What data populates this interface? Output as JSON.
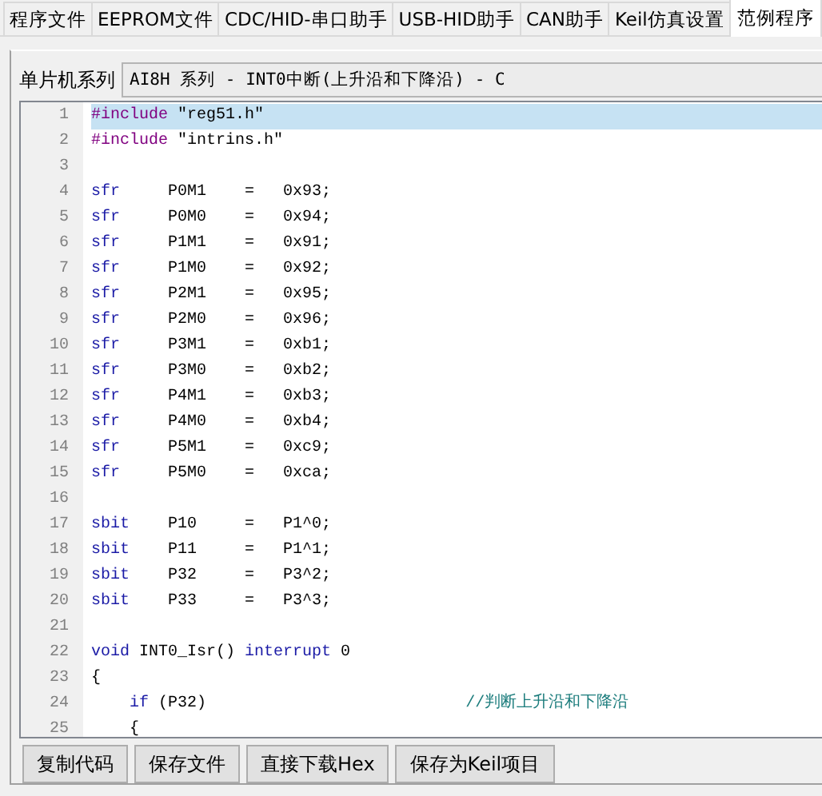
{
  "tabs": [
    {
      "label": "程序文件",
      "selected": false
    },
    {
      "label": "EEPROM文件",
      "selected": false
    },
    {
      "label": "CDC/HID-串口助手",
      "selected": false
    },
    {
      "label": "USB-HID助手",
      "selected": false
    },
    {
      "label": "CAN助手",
      "selected": false
    },
    {
      "label": "Keil仿真设置",
      "selected": false
    },
    {
      "label": "范例程序",
      "selected": true
    }
  ],
  "series_label": "单片机系列",
  "series_select": {
    "value": "AI8H 系列 - INT0中断(上升沿和下降沿) - C"
  },
  "code_lines": [
    {
      "number": "1",
      "selected": true,
      "segments": [
        {
          "kind": "preprocessor",
          "text": "#include"
        },
        {
          "kind": "plain",
          "text": " \"reg51.h\""
        }
      ]
    },
    {
      "number": "2",
      "selected": false,
      "segments": [
        {
          "kind": "preprocessor",
          "text": "#include"
        },
        {
          "kind": "plain",
          "text": " \"intrins.h\""
        }
      ]
    },
    {
      "number": "3",
      "selected": false
    },
    {
      "number": "4",
      "selected": false,
      "segments": [
        {
          "kind": "keyword",
          "text": "sfr"
        },
        {
          "kind": "plain",
          "text": "     P0M1    =   0x93;"
        }
      ]
    },
    {
      "number": "5",
      "selected": false,
      "segments": [
        {
          "kind": "keyword",
          "text": "sfr"
        },
        {
          "kind": "plain",
          "text": "     P0M0    =   0x94;"
        }
      ]
    },
    {
      "number": "6",
      "selected": false,
      "segments": [
        {
          "kind": "keyword",
          "text": "sfr"
        },
        {
          "kind": "plain",
          "text": "     P1M1    =   0x91;"
        }
      ]
    },
    {
      "number": "7",
      "selected": false,
      "segments": [
        {
          "kind": "keyword",
          "text": "sfr"
        },
        {
          "kind": "plain",
          "text": "     P1M0    =   0x92;"
        }
      ]
    },
    {
      "number": "8",
      "selected": false,
      "segments": [
        {
          "kind": "keyword",
          "text": "sfr"
        },
        {
          "kind": "plain",
          "text": "     P2M1    =   0x95;"
        }
      ]
    },
    {
      "number": "9",
      "selected": false,
      "segments": [
        {
          "kind": "keyword",
          "text": "sfr"
        },
        {
          "kind": "plain",
          "text": "     P2M0    =   0x96;"
        }
      ]
    },
    {
      "number": "10",
      "selected": false,
      "segments": [
        {
          "kind": "keyword",
          "text": "sfr"
        },
        {
          "kind": "plain",
          "text": "     P3M1    =   0xb1;"
        }
      ]
    },
    {
      "number": "11",
      "selected": false,
      "segments": [
        {
          "kind": "keyword",
          "text": "sfr"
        },
        {
          "kind": "plain",
          "text": "     P3M0    =   0xb2;"
        }
      ]
    },
    {
      "number": "12",
      "selected": false,
      "segments": [
        {
          "kind": "keyword",
          "text": "sfr"
        },
        {
          "kind": "plain",
          "text": "     P4M1    =   0xb3;"
        }
      ]
    },
    {
      "number": "13",
      "selected": false,
      "segments": [
        {
          "kind": "keyword",
          "text": "sfr"
        },
        {
          "kind": "plain",
          "text": "     P4M0    =   0xb4;"
        }
      ]
    },
    {
      "number": "14",
      "selected": false,
      "segments": [
        {
          "kind": "keyword",
          "text": "sfr"
        },
        {
          "kind": "plain",
          "text": "     P5M1    =   0xc9;"
        }
      ]
    },
    {
      "number": "15",
      "selected": false,
      "segments": [
        {
          "kind": "keyword",
          "text": "sfr"
        },
        {
          "kind": "plain",
          "text": "     P5M0    =   0xca;"
        }
      ]
    },
    {
      "number": "16",
      "selected": false
    },
    {
      "number": "17",
      "selected": false,
      "segments": [
        {
          "kind": "keyword",
          "text": "sbit"
        },
        {
          "kind": "plain",
          "text": "    P10     =   P1^0;"
        }
      ]
    },
    {
      "number": "18",
      "selected": false,
      "segments": [
        {
          "kind": "keyword",
          "text": "sbit"
        },
        {
          "kind": "plain",
          "text": "    P11     =   P1^1;"
        }
      ]
    },
    {
      "number": "19",
      "selected": false,
      "segments": [
        {
          "kind": "keyword",
          "text": "sbit"
        },
        {
          "kind": "plain",
          "text": "    P32     =   P3^2;"
        }
      ]
    },
    {
      "number": "20",
      "selected": false,
      "segments": [
        {
          "kind": "keyword",
          "text": "sbit"
        },
        {
          "kind": "plain",
          "text": "    P33     =   P3^3;"
        }
      ]
    },
    {
      "number": "21",
      "selected": false
    },
    {
      "number": "22",
      "selected": false,
      "segments": [
        {
          "kind": "keyword",
          "text": "void"
        },
        {
          "kind": "plain",
          "text": " INT0_Isr() "
        },
        {
          "kind": "keyword",
          "text": "interrupt"
        },
        {
          "kind": "plain",
          "text": " 0"
        }
      ]
    },
    {
      "number": "23",
      "selected": false,
      "segments": [
        {
          "kind": "plain",
          "text": "{"
        }
      ]
    },
    {
      "number": "24",
      "selected": false,
      "indented": true,
      "segments": [
        {
          "kind": "keyword",
          "text": "if"
        },
        {
          "kind": "plain",
          "text": " (P32)                           "
        },
        {
          "kind": "comment",
          "text": "//判断上升沿和下降沿"
        }
      ]
    },
    {
      "number": "25",
      "selected": false,
      "indented": true,
      "segments": [
        {
          "kind": "plain",
          "text": "{"
        }
      ]
    }
  ],
  "buttons": [
    "复制代码",
    "保存文件",
    "直接下载Hex",
    "保存为Keil项目"
  ]
}
